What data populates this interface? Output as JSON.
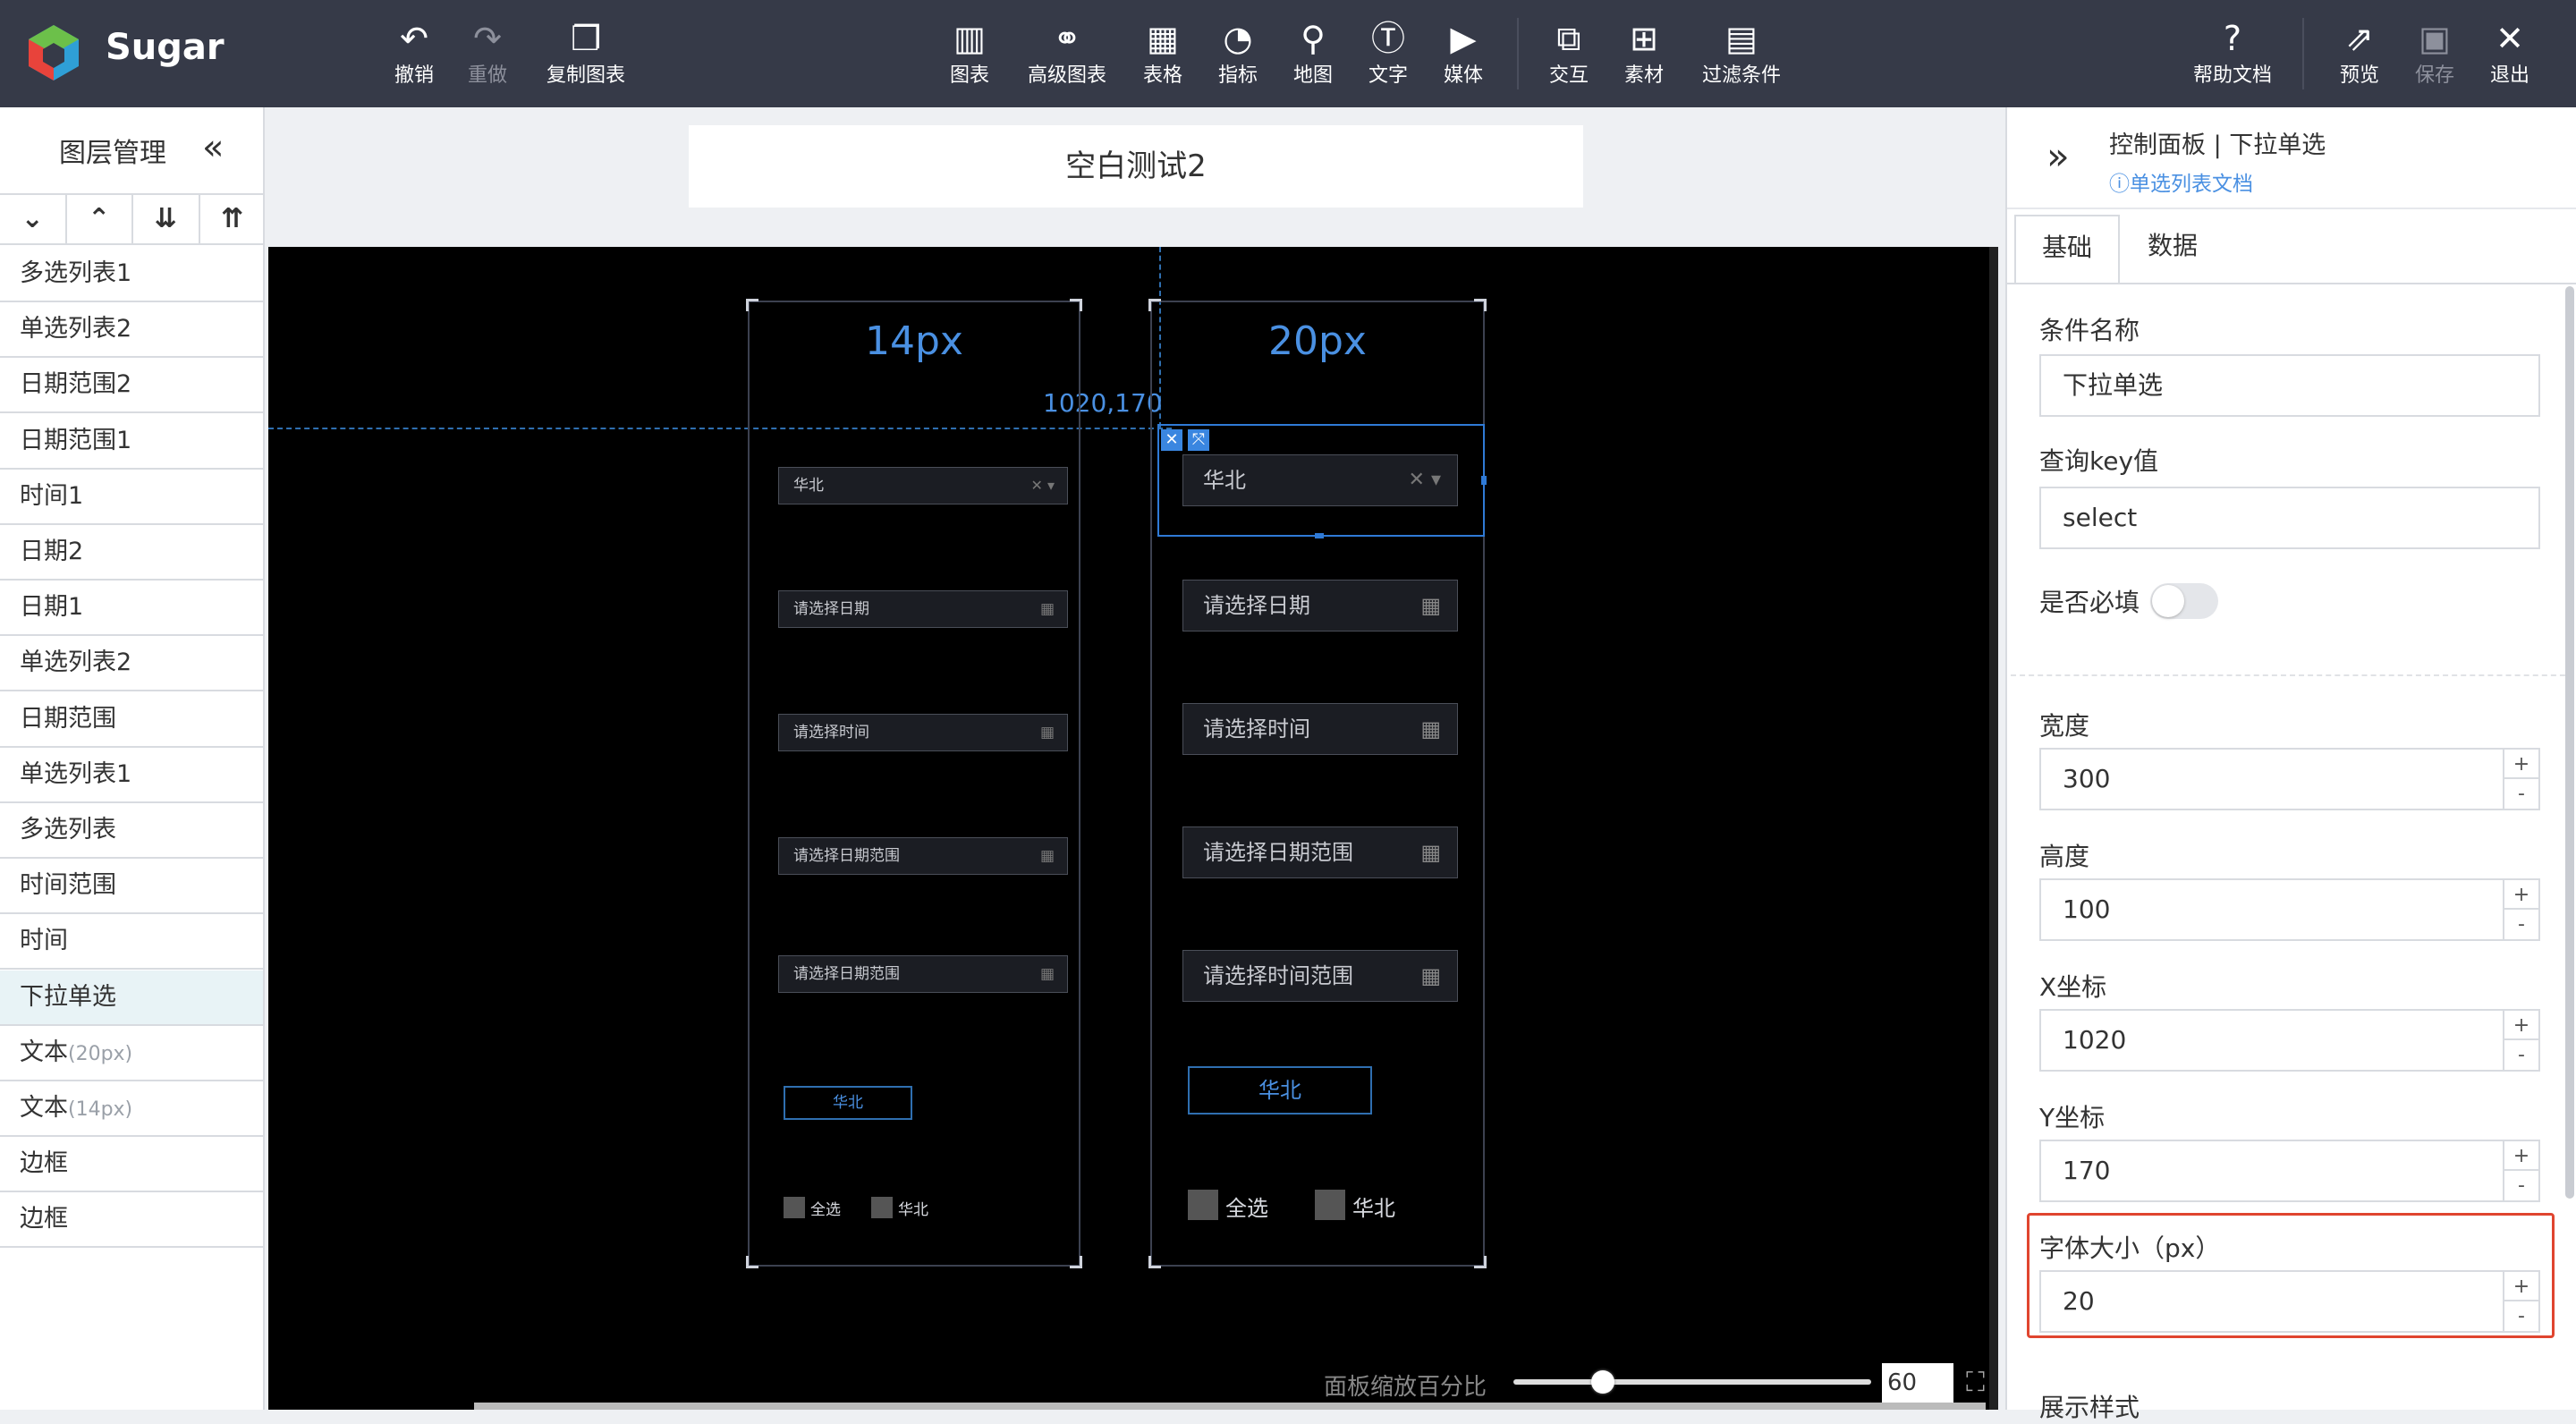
{
  "app": {
    "name": "Sugar",
    "accent": "#4a90e2"
  },
  "toolbar": {
    "undo": "撤销",
    "redo": "重做",
    "copy": "复制图表",
    "chart": "图表",
    "advanced_chart": "高级图表",
    "table": "表格",
    "indicator": "指标",
    "map": "地图",
    "text": "文字",
    "media": "媒体",
    "interaction": "交互",
    "material": "素材",
    "filter": "过滤条件",
    "help": "帮助文档",
    "preview": "预览",
    "save": "保存",
    "exit": "退出"
  },
  "layers": {
    "title": "图层管理",
    "items": [
      {
        "label": "多选列表1",
        "sub": ""
      },
      {
        "label": "单选列表2",
        "sub": ""
      },
      {
        "label": "日期范围2",
        "sub": ""
      },
      {
        "label": "日期范围1",
        "sub": ""
      },
      {
        "label": "时间1",
        "sub": ""
      },
      {
        "label": "日期2",
        "sub": ""
      },
      {
        "label": "日期1",
        "sub": ""
      },
      {
        "label": "单选列表2",
        "sub": ""
      },
      {
        "label": "日期范围",
        "sub": ""
      },
      {
        "label": "单选列表1",
        "sub": ""
      },
      {
        "label": "多选列表",
        "sub": ""
      },
      {
        "label": "时间范围",
        "sub": ""
      },
      {
        "label": "时间",
        "sub": ""
      },
      {
        "label": "下拉单选",
        "sub": ""
      },
      {
        "label": "文本",
        "sub": "(20px)"
      },
      {
        "label": "文本",
        "sub": "(14px)"
      },
      {
        "label": "边框",
        "sub": ""
      },
      {
        "label": "边框",
        "sub": ""
      }
    ],
    "selected_index": 13
  },
  "dashboard": {
    "title": "空白测试2",
    "coord_readout": "1020,170"
  },
  "col14": {
    "heading": "14px",
    "select_value": "华北",
    "date": "请选择日期",
    "time": "请选择时间",
    "date_range": "请选择日期范围",
    "date_range2": "请选择日期范围",
    "radio": "华北",
    "cb_all": "全选",
    "cb_north": "华北"
  },
  "col20": {
    "heading": "20px",
    "select_value": "华北",
    "date": "请选择日期",
    "time": "请选择时间",
    "date_range": "请选择日期范围",
    "time_range": "请选择时间范围",
    "radio": "华北",
    "cb_all": "全选",
    "cb_north": "华北"
  },
  "zoom": {
    "label": "面板缩放百分比",
    "value": "60",
    "level": 0.25
  },
  "panel": {
    "title": "控制面板 | 下拉单选",
    "doc_link": "单选列表文档",
    "tabs": [
      "基础",
      "数据"
    ],
    "active_tab": 0,
    "fields": {
      "name_label": "条件名称",
      "name_value": "下拉单选",
      "key_label": "查询key值",
      "key_value": "select",
      "required_label": "是否必填",
      "width_label": "宽度",
      "width_value": "300",
      "height_label": "高度",
      "height_value": "100",
      "x_label": "X坐标",
      "x_value": "1020",
      "y_label": "Y坐标",
      "y_value": "170",
      "font_label": "字体大小（px）",
      "font_value": "20",
      "display_label": "展示样式"
    },
    "highlight_color": "#e0452f"
  }
}
